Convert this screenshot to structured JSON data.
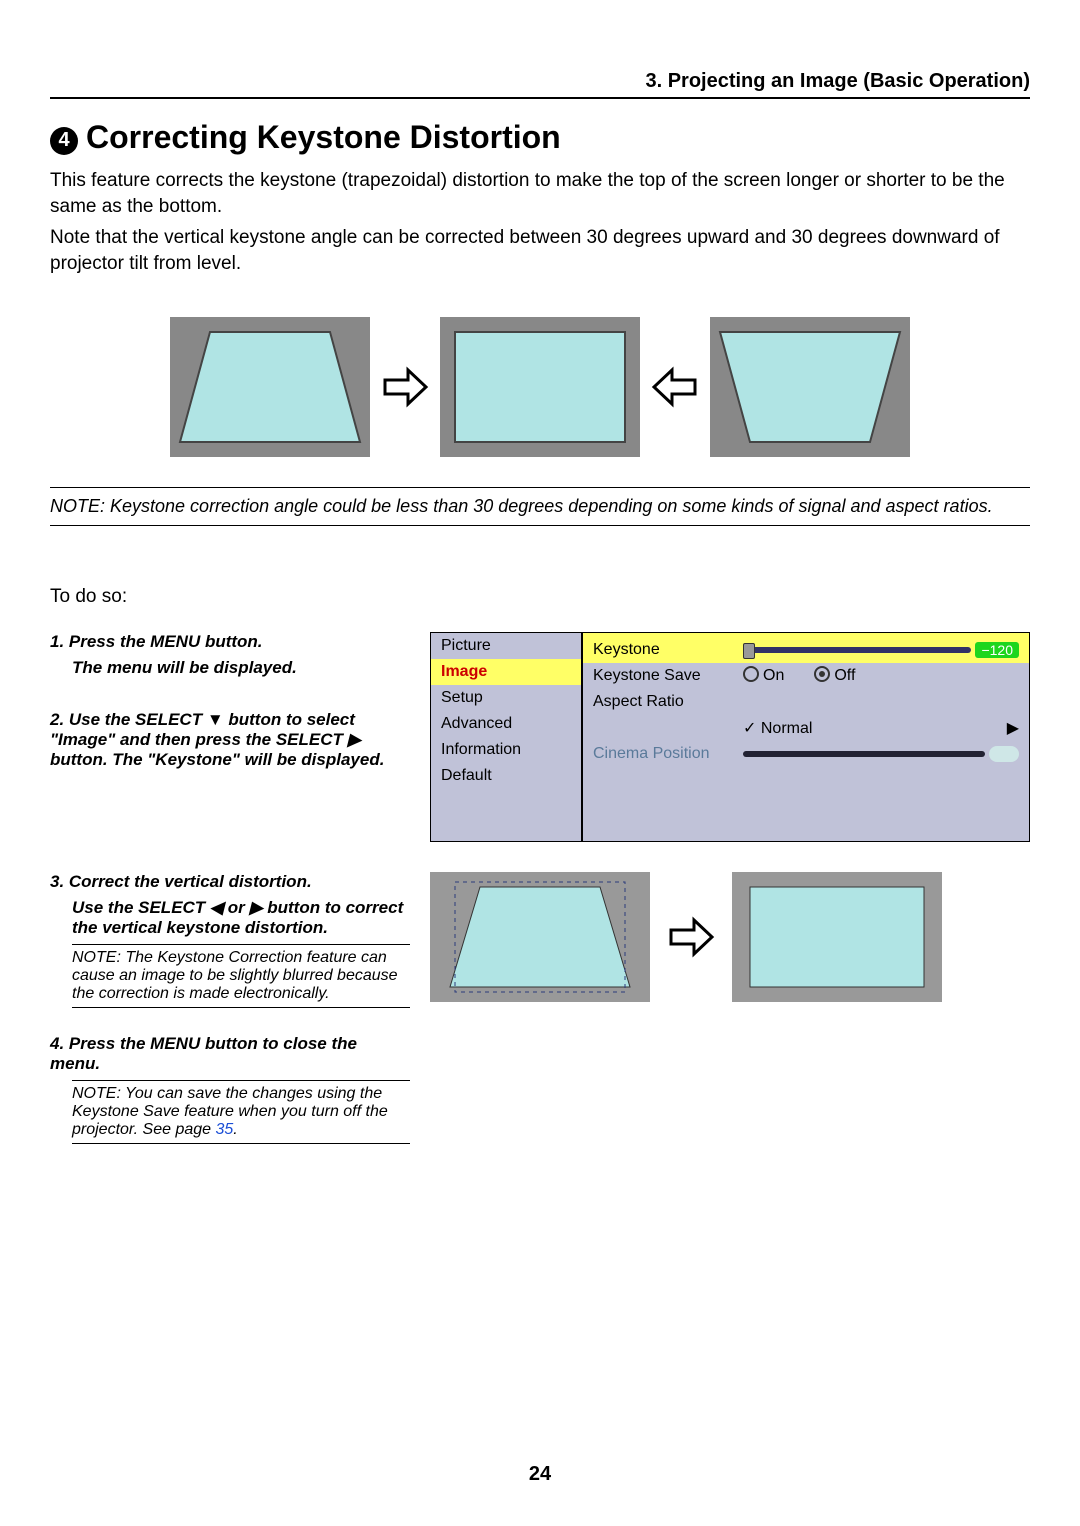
{
  "header": "3. Projecting an Image (Basic Operation)",
  "section_num": "4",
  "section_title": "Correcting Keystone Distortion",
  "p1": "This feature corrects the keystone (trapezoidal) distortion to make the top of the screen longer or shorter to be the same as the bottom.",
  "p2": "Note that the vertical keystone angle can be corrected between 30 degrees upward and 30 degrees downward of projector tilt from level.",
  "note1": "NOTE: Keystone correction angle could be less than 30 degrees depending on some kinds of signal and aspect ratios.",
  "todo": "To do so:",
  "step1_a": "1.  Press the MENU button.",
  "step1_b": "The menu will be displayed.",
  "step2": "2.  Use the SELECT ▼ button to select \"Image\" and then press the SELECT ▶ button. The \"Keystone\" will be displayed.",
  "step3_a": "3.  Correct the vertical distortion.",
  "step3_b": "Use the SELECT ◀ or ▶ button to correct the vertical keystone distortion.",
  "note2": "NOTE: The Keystone Correction feature can cause an image to be slightly blurred because the correction is made electronically.",
  "step4": "4.  Press the MENU button to close the menu.",
  "note3_a": "NOTE: You can save the changes using the Keystone Save feature when you turn off the projector. See page ",
  "note3_link": "35",
  "note3_b": ".",
  "menu": {
    "left": [
      "Picture",
      "Image",
      "Setup",
      "Advanced",
      "Information",
      "Default"
    ],
    "right": {
      "keystone": "Keystone",
      "keystone_val": "−120",
      "save": "Keystone Save",
      "on": "On",
      "off": "Off",
      "aspect": "Aspect Ratio",
      "normal": "Normal",
      "cinema": "Cinema Position"
    }
  },
  "page_num": "24"
}
